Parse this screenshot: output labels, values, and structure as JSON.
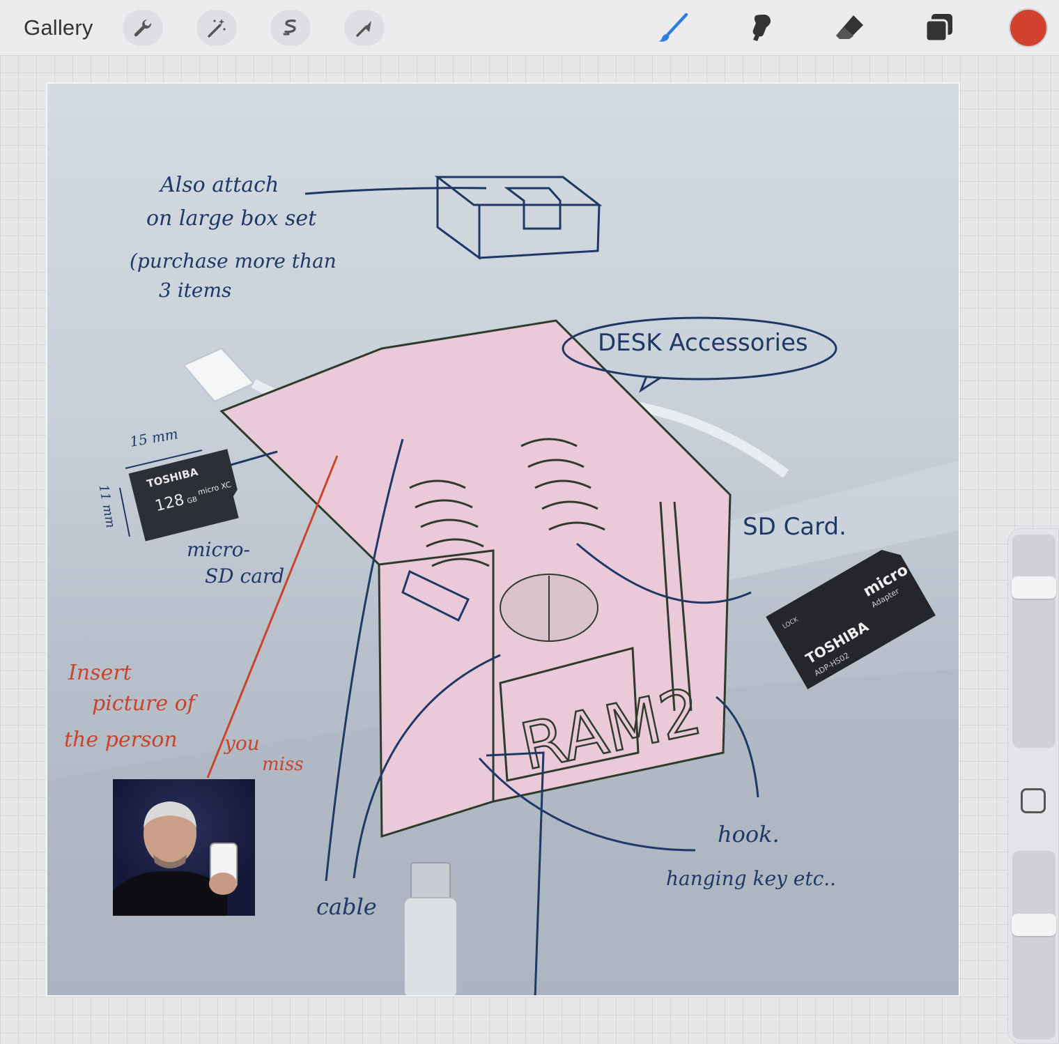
{
  "toolbar": {
    "gallery_label": "Gallery",
    "left_tools": [
      "wrench-icon",
      "magic-wand-icon",
      "selection-icon",
      "transform-arrow-icon"
    ],
    "right_tools": [
      "brush-icon",
      "smudge-icon",
      "eraser-icon",
      "layers-icon"
    ],
    "current_color": "#d2412d",
    "accent_brush_color": "#2f7fe0"
  },
  "sidebar": {
    "size_level": 0.78,
    "opacity_level": 0.62
  },
  "canvas": {
    "annotations": {
      "box_note_line1": "Also attach",
      "box_note_line2": "on large box set",
      "box_note_line3": "(purchase more than",
      "box_note_line4": "3 items",
      "bubble": "DESK Accessories",
      "micro_size_w": "15 mm",
      "micro_size_h": "11 mm",
      "micro_label_1": "micro-",
      "micro_label_2": "SD card",
      "sd_label": "SD Card.",
      "red_line1": "Insert",
      "red_line2": "picture of",
      "red_line3": "the person",
      "red_line4": "you",
      "red_line5": "miss",
      "cable_label": "cable",
      "hook_label": "hook.",
      "hook_sub": "hanging key etc..",
      "ram_text": "RAM2"
    },
    "microsd": {
      "brand": "TOSHIBA",
      "capacity": "128",
      "unit": "GB",
      "type": "micro XC"
    },
    "sd_adapter": {
      "brand": "TOSHIBA",
      "model": "ADP-HS02",
      "kind": "micro",
      "word": "Adapter",
      "lock": "LOCK"
    },
    "colors": {
      "ink_blue": "#1f3866",
      "ink_red": "#c8452a",
      "holder_pink": "#eac9d8",
      "pencil_green": "#2f3b2b"
    }
  }
}
